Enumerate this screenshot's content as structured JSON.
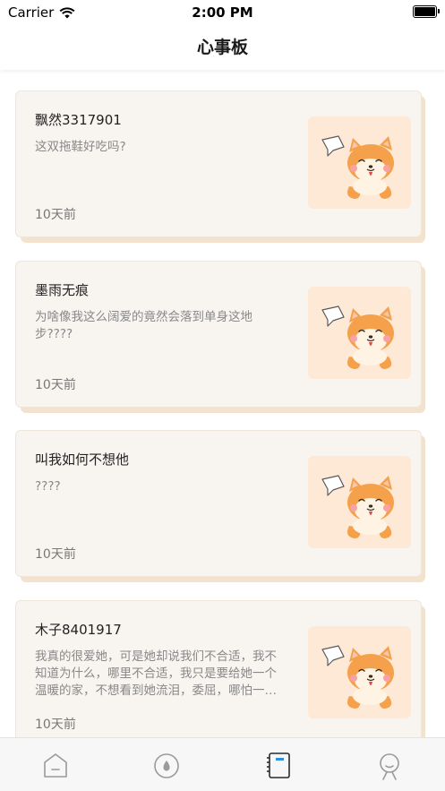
{
  "status_bar": {
    "carrier": "Carrier",
    "time": "2:00 PM"
  },
  "nav": {
    "title": "心事板"
  },
  "posts": [
    {
      "title": "飘然3317901",
      "body": "这双拖鞋好吃吗?",
      "time": "10天前"
    },
    {
      "title": "墨雨无痕",
      "body": "为啥像我这么阔爱的竟然会落到单身这地步????",
      "time": "10天前"
    },
    {
      "title": "叫我如何不想他",
      "body": "????",
      "time": "10天前"
    },
    {
      "title": "木子8401917",
      "body": "我真的很爱她，可是她却说我们不合适，我不知道为什么，哪里不合适，我只是要给她一个温暖的家，不想看到她流泪，委屈，哪怕一点点伤害",
      "time": "10天前"
    }
  ],
  "tabs": [
    {
      "icon": "home-icon",
      "active": false
    },
    {
      "icon": "discover-icon",
      "active": false
    },
    {
      "icon": "notebook-icon",
      "active": true
    },
    {
      "icon": "profile-icon",
      "active": false
    }
  ],
  "colors": {
    "accent": "#2f8fd8",
    "card_bg": "#f8f5f1",
    "card_shadow": "#f3e2cd",
    "thumb_bg": "#fde9d6",
    "shiba": "#f5a04a"
  }
}
